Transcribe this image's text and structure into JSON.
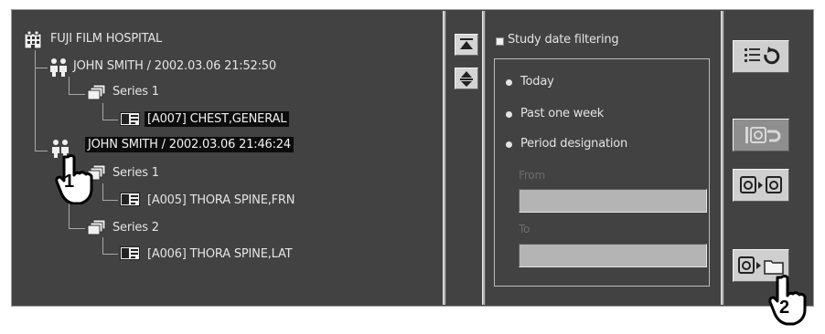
{
  "tree": {
    "root_label": "FUJI FILM HOSPITAL",
    "studies": [
      {
        "label": "JOHN SMITH / 2002.03.06  21:52:50",
        "series": [
          {
            "label": "Series 1",
            "images": [
              {
                "label": "[A007] CHEST,GENERAL"
              }
            ]
          }
        ]
      },
      {
        "label": "JOHN SMITH / 2002.03.06  21:46:24",
        "series": [
          {
            "label": "Series 1",
            "images": [
              {
                "label": "[A005] THORA SPINE,FRN"
              }
            ]
          },
          {
            "label": "Series 2",
            "images": [
              {
                "label": "[A006] THORA SPINE,LAT"
              }
            ]
          }
        ]
      }
    ]
  },
  "filter": {
    "checkbox_label": "Study date filtering",
    "options": [
      "Today",
      "Past one week",
      "Period designation"
    ],
    "from_label": "From",
    "to_label": "To",
    "from_value": "",
    "to_value": ""
  },
  "callouts": {
    "first": "1",
    "second": "2"
  },
  "colors": {
    "panel": "#424242",
    "highlight": "#0c0c0c",
    "text": "#e4e4e4"
  }
}
